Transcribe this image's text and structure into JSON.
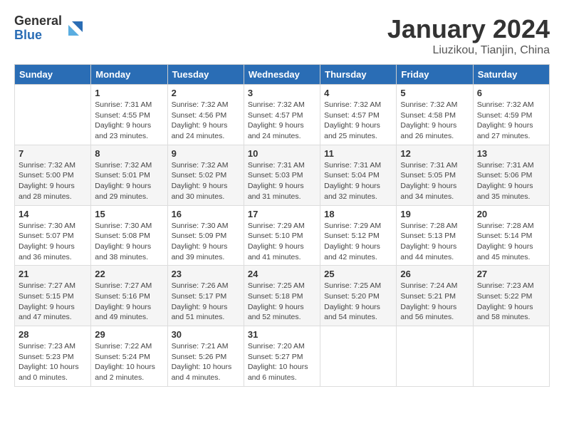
{
  "header": {
    "logo_general": "General",
    "logo_blue": "Blue",
    "month_title": "January 2024",
    "location": "Liuzikou, Tianjin, China"
  },
  "days_of_week": [
    "Sunday",
    "Monday",
    "Tuesday",
    "Wednesday",
    "Thursday",
    "Friday",
    "Saturday"
  ],
  "weeks": [
    [
      {
        "day": "",
        "info": ""
      },
      {
        "day": "1",
        "info": "Sunrise: 7:31 AM\nSunset: 4:55 PM\nDaylight: 9 hours\nand 23 minutes."
      },
      {
        "day": "2",
        "info": "Sunrise: 7:32 AM\nSunset: 4:56 PM\nDaylight: 9 hours\nand 24 minutes."
      },
      {
        "day": "3",
        "info": "Sunrise: 7:32 AM\nSunset: 4:57 PM\nDaylight: 9 hours\nand 24 minutes."
      },
      {
        "day": "4",
        "info": "Sunrise: 7:32 AM\nSunset: 4:57 PM\nDaylight: 9 hours\nand 25 minutes."
      },
      {
        "day": "5",
        "info": "Sunrise: 7:32 AM\nSunset: 4:58 PM\nDaylight: 9 hours\nand 26 minutes."
      },
      {
        "day": "6",
        "info": "Sunrise: 7:32 AM\nSunset: 4:59 PM\nDaylight: 9 hours\nand 27 minutes."
      }
    ],
    [
      {
        "day": "7",
        "info": "Sunrise: 7:32 AM\nSunset: 5:00 PM\nDaylight: 9 hours\nand 28 minutes."
      },
      {
        "day": "8",
        "info": "Sunrise: 7:32 AM\nSunset: 5:01 PM\nDaylight: 9 hours\nand 29 minutes."
      },
      {
        "day": "9",
        "info": "Sunrise: 7:32 AM\nSunset: 5:02 PM\nDaylight: 9 hours\nand 30 minutes."
      },
      {
        "day": "10",
        "info": "Sunrise: 7:31 AM\nSunset: 5:03 PM\nDaylight: 9 hours\nand 31 minutes."
      },
      {
        "day": "11",
        "info": "Sunrise: 7:31 AM\nSunset: 5:04 PM\nDaylight: 9 hours\nand 32 minutes."
      },
      {
        "day": "12",
        "info": "Sunrise: 7:31 AM\nSunset: 5:05 PM\nDaylight: 9 hours\nand 34 minutes."
      },
      {
        "day": "13",
        "info": "Sunrise: 7:31 AM\nSunset: 5:06 PM\nDaylight: 9 hours\nand 35 minutes."
      }
    ],
    [
      {
        "day": "14",
        "info": "Sunrise: 7:30 AM\nSunset: 5:07 PM\nDaylight: 9 hours\nand 36 minutes."
      },
      {
        "day": "15",
        "info": "Sunrise: 7:30 AM\nSunset: 5:08 PM\nDaylight: 9 hours\nand 38 minutes."
      },
      {
        "day": "16",
        "info": "Sunrise: 7:30 AM\nSunset: 5:09 PM\nDaylight: 9 hours\nand 39 minutes."
      },
      {
        "day": "17",
        "info": "Sunrise: 7:29 AM\nSunset: 5:10 PM\nDaylight: 9 hours\nand 41 minutes."
      },
      {
        "day": "18",
        "info": "Sunrise: 7:29 AM\nSunset: 5:12 PM\nDaylight: 9 hours\nand 42 minutes."
      },
      {
        "day": "19",
        "info": "Sunrise: 7:28 AM\nSunset: 5:13 PM\nDaylight: 9 hours\nand 44 minutes."
      },
      {
        "day": "20",
        "info": "Sunrise: 7:28 AM\nSunset: 5:14 PM\nDaylight: 9 hours\nand 45 minutes."
      }
    ],
    [
      {
        "day": "21",
        "info": "Sunrise: 7:27 AM\nSunset: 5:15 PM\nDaylight: 9 hours\nand 47 minutes."
      },
      {
        "day": "22",
        "info": "Sunrise: 7:27 AM\nSunset: 5:16 PM\nDaylight: 9 hours\nand 49 minutes."
      },
      {
        "day": "23",
        "info": "Sunrise: 7:26 AM\nSunset: 5:17 PM\nDaylight: 9 hours\nand 51 minutes."
      },
      {
        "day": "24",
        "info": "Sunrise: 7:25 AM\nSunset: 5:18 PM\nDaylight: 9 hours\nand 52 minutes."
      },
      {
        "day": "25",
        "info": "Sunrise: 7:25 AM\nSunset: 5:20 PM\nDaylight: 9 hours\nand 54 minutes."
      },
      {
        "day": "26",
        "info": "Sunrise: 7:24 AM\nSunset: 5:21 PM\nDaylight: 9 hours\nand 56 minutes."
      },
      {
        "day": "27",
        "info": "Sunrise: 7:23 AM\nSunset: 5:22 PM\nDaylight: 9 hours\nand 58 minutes."
      }
    ],
    [
      {
        "day": "28",
        "info": "Sunrise: 7:23 AM\nSunset: 5:23 PM\nDaylight: 10 hours\nand 0 minutes."
      },
      {
        "day": "29",
        "info": "Sunrise: 7:22 AM\nSunset: 5:24 PM\nDaylight: 10 hours\nand 2 minutes."
      },
      {
        "day": "30",
        "info": "Sunrise: 7:21 AM\nSunset: 5:26 PM\nDaylight: 10 hours\nand 4 minutes."
      },
      {
        "day": "31",
        "info": "Sunrise: 7:20 AM\nSunset: 5:27 PM\nDaylight: 10 hours\nand 6 minutes."
      },
      {
        "day": "",
        "info": ""
      },
      {
        "day": "",
        "info": ""
      },
      {
        "day": "",
        "info": ""
      }
    ]
  ]
}
